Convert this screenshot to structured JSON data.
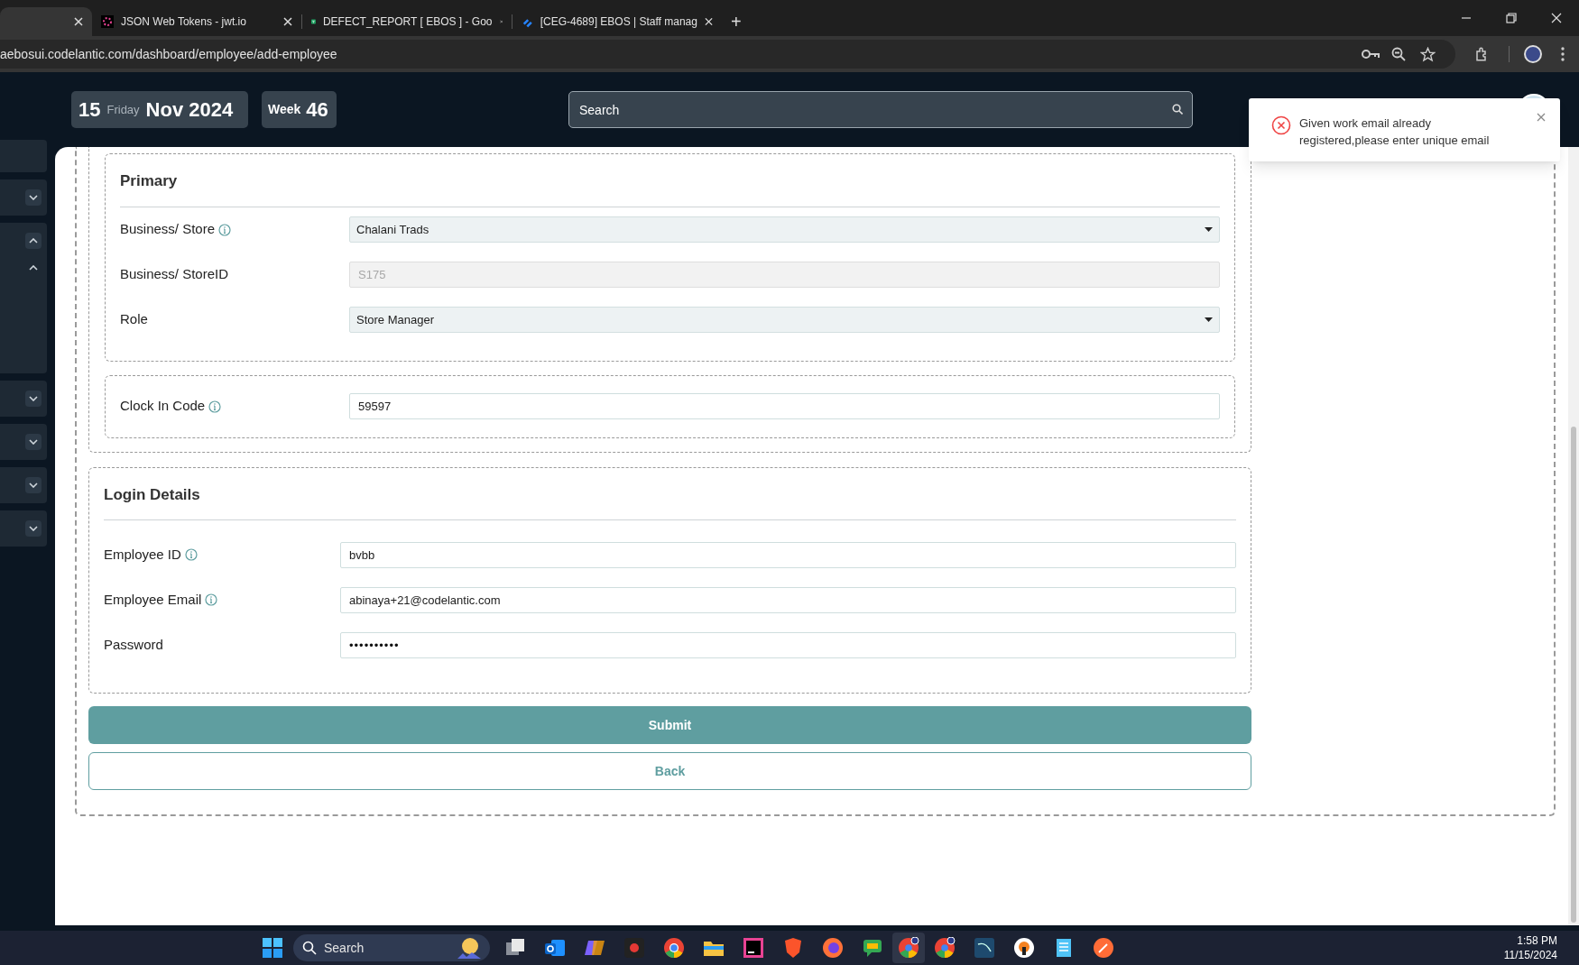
{
  "browser": {
    "tabs": [
      {
        "selected": true
      },
      {
        "title": "JSON Web Tokens - jwt.io",
        "selected": false
      },
      {
        "title": "DEFECT_REPORT [ EBOS ] - Goo",
        "selected": false
      },
      {
        "title": "[CEG-4689] EBOS | Staff manag",
        "selected": false
      }
    ],
    "new_tab": "+",
    "url": "aebosui.codelantic.com/dashboard/employee/add-employee"
  },
  "header": {
    "date": {
      "day": "15",
      "weekday": "Friday",
      "month_year": "Nov 2024"
    },
    "week": {
      "label": "Week",
      "number": "46"
    },
    "search": {
      "placeholder": "Search"
    }
  },
  "toast": {
    "kind": "error",
    "message": "Given work email already registered,please enter unique email"
  },
  "sidebar": {
    "items": [
      {
        "kind": "plain"
      },
      {
        "kind": "group",
        "expanded": false
      },
      {
        "kind": "group",
        "expanded": true,
        "children": [
          {
            "kind": "group",
            "expanded": true
          }
        ]
      },
      {
        "kind": "group",
        "expanded": false
      },
      {
        "kind": "group",
        "expanded": false
      },
      {
        "kind": "group",
        "expanded": false
      },
      {
        "kind": "group",
        "expanded": false
      }
    ]
  },
  "form": {
    "primary": {
      "title": "Primary",
      "fields": [
        {
          "label": "Business/ Store",
          "info": true,
          "kind": "select",
          "value": "Chalani Trads"
        },
        {
          "label": "Business/ StoreID",
          "info": false,
          "kind": "readonly",
          "value": "S175"
        },
        {
          "label": "Role",
          "info": false,
          "kind": "select",
          "value": "Store Manager"
        }
      ]
    },
    "clock": {
      "fields": [
        {
          "label": "Clock In Code",
          "info": true,
          "kind": "text",
          "value": "59597"
        }
      ]
    },
    "login": {
      "title": "Login Details",
      "fields": [
        {
          "label": "Employee ID",
          "info": true,
          "kind": "text",
          "value": "bvbb"
        },
        {
          "label": "Employee Email",
          "info": true,
          "kind": "text",
          "value": "abinaya+21@codelantic.com"
        },
        {
          "label": "Password",
          "info": false,
          "kind": "password",
          "value": "••••••••••"
        }
      ]
    },
    "buttons": [
      {
        "label": "Submit",
        "kind": "primary"
      },
      {
        "label": "Back",
        "kind": "outline"
      }
    ]
  },
  "taskbar": {
    "search": {
      "placeholder": "Search"
    },
    "time": "1:58 PM",
    "date": "11/15/2024"
  }
}
